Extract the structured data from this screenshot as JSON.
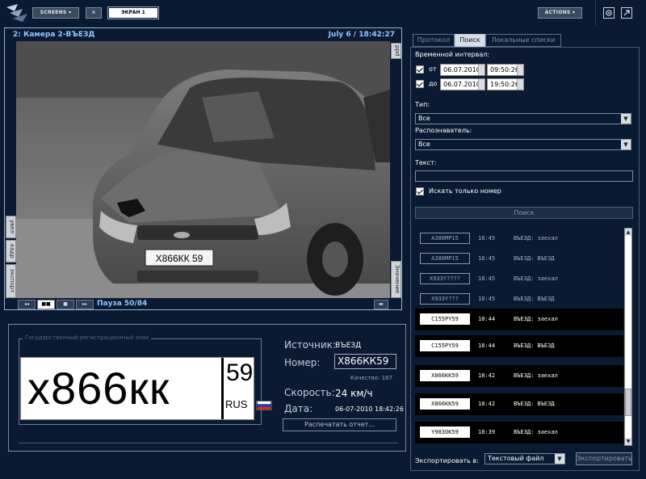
{
  "topbar": {
    "screens_label": "SCREENS",
    "close_label": "×",
    "screen_tab_label": "ЭКРАН 1",
    "actions_label": "ACTIONS"
  },
  "video": {
    "camera_title": "2: Камера 2-ВЪЕЗД",
    "datetime": "July 6 / 18:42:27",
    "pause_status": "Пауза 50/84",
    "tab_right_top": "ppd",
    "tab_right_bottom": "Значение",
    "tab_left_scale": "увел",
    "tab_left_frame": "кадр",
    "tab_left_export": "экспорт",
    "controls": [
      "◂◂",
      "■■",
      "■",
      "▸▸"
    ],
    "min_button": "▬",
    "scene_plate_text": "Х866КК 59"
  },
  "info": {
    "plate_section_title": "Государственный регистрационный знак",
    "plate_main": "х866кк",
    "plate_region": "59",
    "plate_country": "RUS",
    "source_label": "Источник:",
    "source_value": "ВЪЕЗД",
    "number_label": "Номер:",
    "number_value": "Х866КК59",
    "quality_text": "Качество: 167",
    "speed_label": "Скорость:",
    "speed_value": "24 км/ч",
    "date_label": "Дата:",
    "date_value": "06-07-2010 18:42:26",
    "print_button": "Распечатать отчет..."
  },
  "search": {
    "tabs": [
      {
        "label": "Протокол",
        "active": false
      },
      {
        "label": "Поиск",
        "active": true
      },
      {
        "label": "Локальные списки",
        "active": false
      }
    ],
    "interval_label": "Временной интервал:",
    "from_label": "от",
    "to_label": "до",
    "from_date": "06.07.2010",
    "from_time": "09:50:26",
    "to_date": "06.07.2010",
    "to_time": "19:50:26",
    "type_label": "Тип:",
    "type_value": "Все",
    "recognizer_label": "Распознаватель:",
    "recognizer_value": "Все",
    "text_label": "Текст:",
    "text_value": "",
    "only_number_label": "Искать только номер",
    "search_button": "Поиск",
    "results": [
      {
        "plate": "A380MP15",
        "time": "18:45",
        "event": "ВЪЕЗД: заехал",
        "selected": false
      },
      {
        "plate": "A380MP15",
        "time": "18:45",
        "event": "ВЪЕЗД: ВЪЕЗД",
        "selected": false
      },
      {
        "plate": "X933Y????",
        "time": "18:45",
        "event": "ВЪЕЗД: заехал",
        "selected": false
      },
      {
        "plate": "X933Y???",
        "time": "18:45",
        "event": "ВЪЕЗД: ВЪЕЗД",
        "selected": false
      },
      {
        "plate": "C155PY59",
        "time": "18:44",
        "event": "ВЪЕЗД: заехал",
        "selected": true
      },
      {
        "plate": "C155PY59",
        "time": "18:44",
        "event": "ВЪЕЗД: ВЪЕЗД",
        "selected": true
      },
      {
        "plate": "X866KK59",
        "time": "18:42",
        "event": "ВЪЕЗД: заехал",
        "selected": true
      },
      {
        "plate": "X866KK59",
        "time": "18:42",
        "event": "ВЪЕЗД: ВЪЕЗД",
        "selected": true
      },
      {
        "plate": "Y983OK59",
        "time": "18:39",
        "event": "ВЪЕЗД: заехал",
        "selected": true
      }
    ],
    "export_label": "Экспортировать в:",
    "export_format": "Текстовый файл",
    "export_button": "Экспортировать"
  },
  "colors": {
    "background": "#0b1a33",
    "accent_text": "#8ec7ff",
    "flag": [
      "#ffffff",
      "#1c3fbf",
      "#d52b1e"
    ]
  }
}
